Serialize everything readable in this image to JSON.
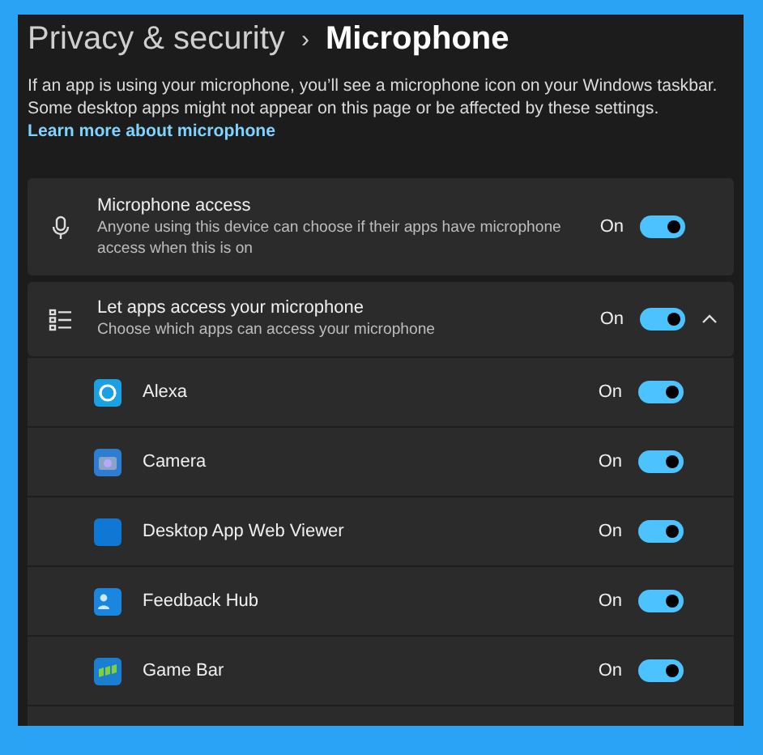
{
  "breadcrumb": {
    "parent": "Privacy & security",
    "separator": "›",
    "current": "Microphone"
  },
  "description": {
    "text": "If an app is using your microphone, you’ll see a microphone icon on your Windows taskbar. Some desktop apps might not appear on this page or be affected by these settings.",
    "link": "Learn more about microphone"
  },
  "settings": [
    {
      "title": "Microphone access",
      "subtitle": "Anyone using this device can choose if their apps have microphone access when this is on",
      "state_label": "On",
      "on": true
    },
    {
      "title": "Let apps access your microphone",
      "subtitle": "Choose which apps can access your microphone",
      "state_label": "On",
      "on": true,
      "expanded": true
    }
  ],
  "apps": [
    {
      "name": "Alexa",
      "state_label": "On",
      "on": true
    },
    {
      "name": "Camera",
      "state_label": "On",
      "on": true
    },
    {
      "name": "Desktop App Web Viewer",
      "state_label": "On",
      "on": true
    },
    {
      "name": "Feedback Hub",
      "state_label": "On",
      "on": true
    },
    {
      "name": "Game Bar",
      "state_label": "On",
      "on": true
    }
  ]
}
